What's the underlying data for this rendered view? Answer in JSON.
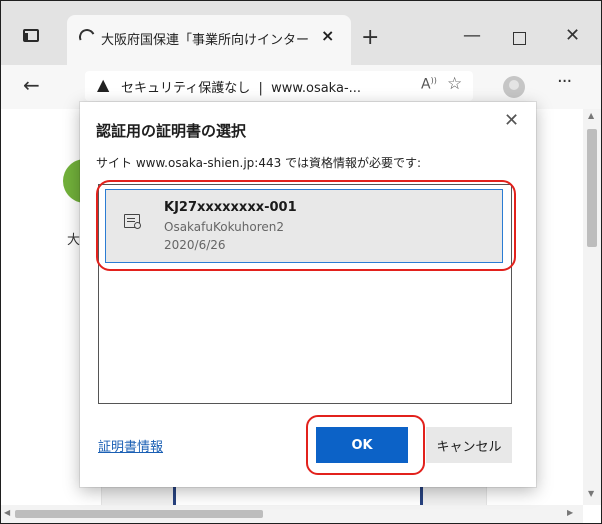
{
  "browser": {
    "tab_title": "大阪府国保連「事業所向けインター",
    "tab_close": "×",
    "new_tab": "+",
    "window_controls": {
      "minimize": "—",
      "close": "✕"
    },
    "back": "←",
    "security_label": "セキュリティ保護なし",
    "separator": "|",
    "url": "www.osaka-...",
    "read_aloud": "A",
    "more": "···"
  },
  "page": {
    "partial_text": "大阪"
  },
  "dialog": {
    "title": "認証用の証明書の選択",
    "close": "✕",
    "subtitle": "サイト www.osaka-shien.jp:443 では資格情報が必要です:",
    "certificates": [
      {
        "name": "KJ27xxxxxxxx-001",
        "issuer": "OsakafuKokuhoren2",
        "date": "2020/6/26"
      }
    ],
    "cert_info_link": "証明書情報",
    "ok_button": "OK",
    "cancel_button": "キャンセル"
  },
  "colors": {
    "accent_blue": "#0c62c7",
    "highlight_red": "#e2211c",
    "selection_border": "#2b7cd3"
  }
}
